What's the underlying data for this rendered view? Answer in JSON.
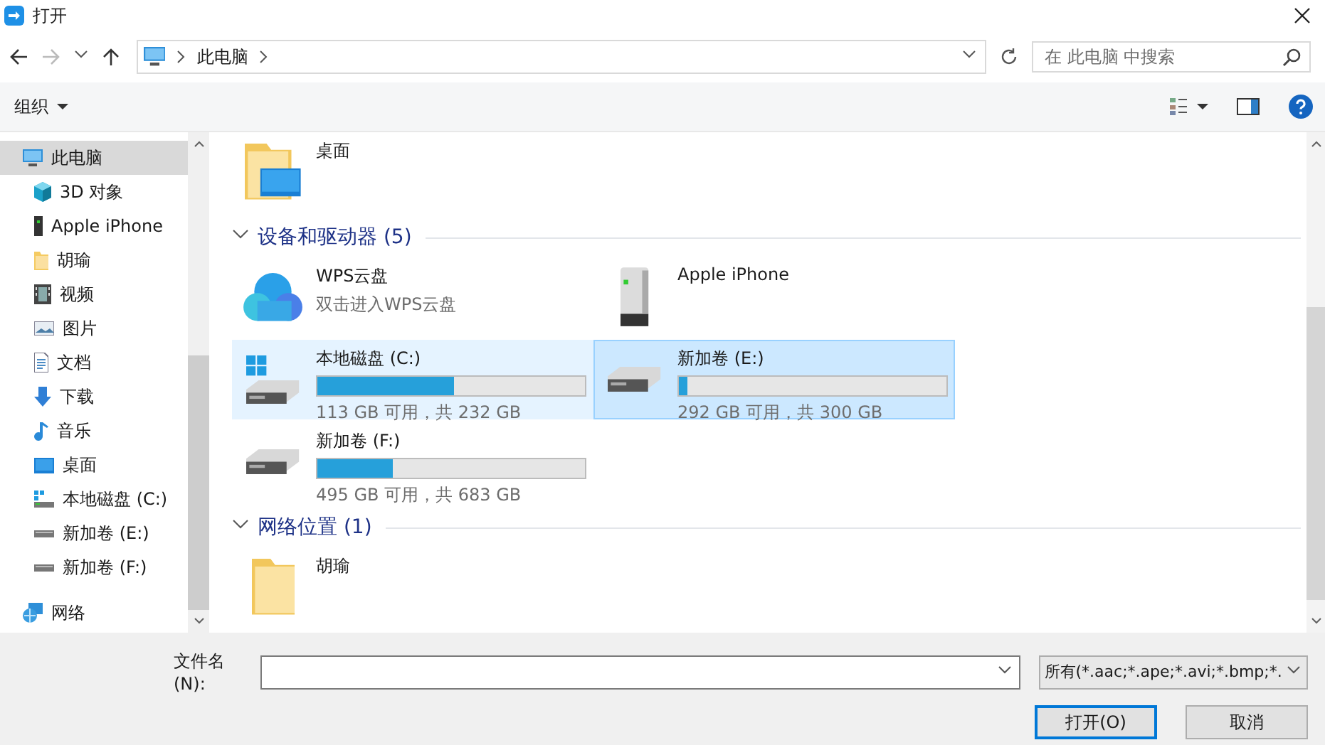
{
  "window": {
    "title": "打开"
  },
  "address": {
    "segments": [
      "此电脑"
    ]
  },
  "search": {
    "placeholder": "在 此电脑 中搜索"
  },
  "toolbar": {
    "organize": "组织"
  },
  "sidebar": {
    "items": [
      {
        "label": "此电脑",
        "kind": "computer",
        "selected": true,
        "children": [
          {
            "label": "3D 对象",
            "kind": "objects",
            "selected": false
          },
          {
            "label": "Apple iPhone",
            "kind": "phone",
            "selected": false
          },
          {
            "label": "胡瑜",
            "kind": "folder",
            "selected": false
          },
          {
            "label": "视频",
            "kind": "videos",
            "selected": false
          },
          {
            "label": "图片",
            "kind": "pictures",
            "selected": false
          },
          {
            "label": "文档",
            "kind": "documents",
            "selected": false
          },
          {
            "label": "下载",
            "kind": "downloads",
            "selected": false
          },
          {
            "label": "音乐",
            "kind": "music",
            "selected": false
          },
          {
            "label": "桌面",
            "kind": "desktop",
            "selected": false
          },
          {
            "label": "本地磁盘 (C:)",
            "kind": "systemdrive",
            "selected": false
          },
          {
            "label": "新加卷 (E:)",
            "kind": "drive",
            "selected": false
          },
          {
            "label": "新加卷 (F:)",
            "kind": "drive",
            "selected": false
          }
        ]
      },
      {
        "label": "网络",
        "kind": "network",
        "selected": false
      }
    ]
  },
  "sections": [
    {
      "items": [
        {
          "kind": "desktopfolder",
          "name": "桌面",
          "selected": false,
          "hovered": false
        }
      ]
    },
    {
      "title": "设备和驱动器 (5)",
      "expanded": true,
      "items": [
        {
          "kind": "cloud",
          "name": "WPS云盘",
          "subtitle": "双击进入WPS云盘",
          "selected": false,
          "hovered": false
        },
        {
          "kind": "device",
          "name": "Apple iPhone",
          "selected": false,
          "hovered": false
        },
        {
          "kind": "systemdrive",
          "name": "本地磁盘 (C:)",
          "level": 0.51,
          "free": "113 GB 可用，共 232 GB",
          "selected": false,
          "hovered": true
        },
        {
          "kind": "drive",
          "name": "新加卷 (E:)",
          "level": 0.03,
          "free": "292 GB 可用，共 300 GB",
          "selected": true,
          "hovered": false
        },
        {
          "kind": "drive",
          "name": "新加卷 (F:)",
          "level": 0.28,
          "free": "495 GB 可用，共 683 GB",
          "selected": false,
          "hovered": false
        }
      ]
    },
    {
      "title": "网络位置 (1)",
      "expanded": true,
      "items": [
        {
          "kind": "folder",
          "name": "胡瑜",
          "selected": false,
          "hovered": false
        }
      ]
    }
  ],
  "footer": {
    "filename_label": "文件名(N):",
    "filter": "所有(*.aac;*.ape;*.avi;*.bmp;*.",
    "open": "打开(O)",
    "cancel": "取消"
  }
}
